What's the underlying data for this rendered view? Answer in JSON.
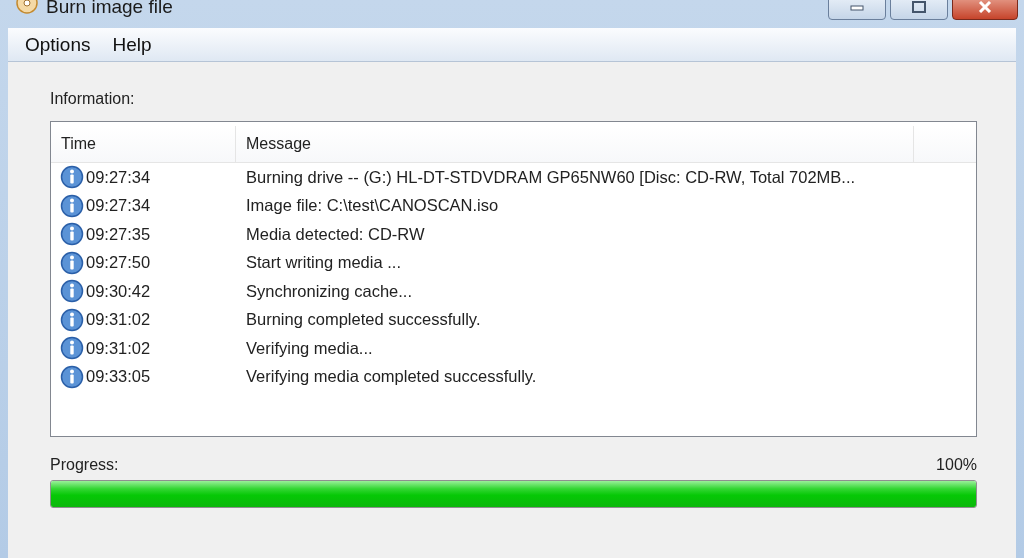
{
  "window": {
    "title": "Burn image file"
  },
  "menu": [
    {
      "label": "Options"
    },
    {
      "label": "Help"
    }
  ],
  "information_label": "Information:",
  "log": {
    "columns": [
      "Time",
      "Message"
    ],
    "rows": [
      {
        "kind": "info",
        "time": "09:27:34",
        "message": "Burning drive -- (G:) HL-DT-STDVDRAM GP65NW60 [Disc: CD-RW, Total 702MB..."
      },
      {
        "kind": "info",
        "time": "09:27:34",
        "message": "Image file:  C:\\test\\CANOSCAN.iso"
      },
      {
        "kind": "info",
        "time": "09:27:35",
        "message": "Media detected: CD-RW"
      },
      {
        "kind": "info",
        "time": "09:27:50",
        "message": "Start writing media ..."
      },
      {
        "kind": "info",
        "time": "09:30:42",
        "message": "Synchronizing cache..."
      },
      {
        "kind": "info",
        "time": "09:31:02",
        "message": "Burning completed successfully."
      },
      {
        "kind": "info",
        "time": "09:31:02",
        "message": "Verifying media..."
      },
      {
        "kind": "info",
        "time": "09:33:05",
        "message": "Verifying media completed successfully."
      }
    ]
  },
  "progress": {
    "label": "Progress:",
    "percent": "100%",
    "level": 1
  }
}
